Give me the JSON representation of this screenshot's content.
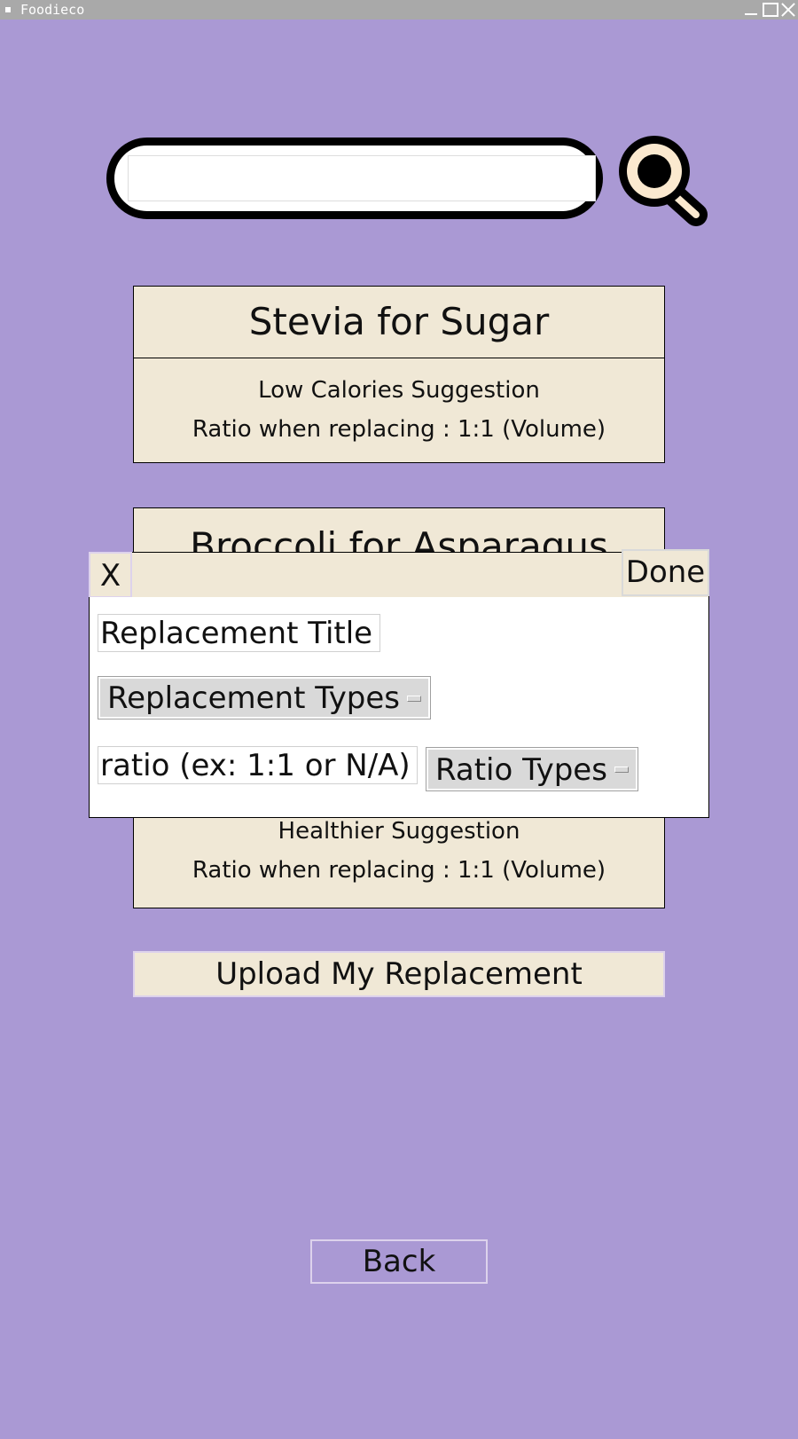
{
  "window": {
    "title": "Foodieco"
  },
  "search": {
    "value": "",
    "placeholder": ""
  },
  "cards": [
    {
      "title": "Stevia for Sugar",
      "subtitle": "Low Calories Suggestion",
      "ratio": "Ratio when replacing : 1:1 (Volume)"
    },
    {
      "title": "Broccoli for Asparagus",
      "subtitle": "Healthier Suggestion",
      "ratio": "Ratio when replacing : 1:1 (Volume)"
    }
  ],
  "upload_label": "Upload My Replacement",
  "back_label": "Back",
  "modal": {
    "close_label": "X",
    "done_label": "Done",
    "title_placeholder": "Replacement Title",
    "types_dropdown": "Replacement Types",
    "ratio_placeholder": "ratio (ex: 1:1 or N/A)",
    "ratio_dropdown": "Ratio Types"
  },
  "colors": {
    "background": "#aa99d4",
    "card": "#f0e8d6",
    "search_icon_fill": "#fbe9cf",
    "dropdown": "#d9d9d9"
  }
}
